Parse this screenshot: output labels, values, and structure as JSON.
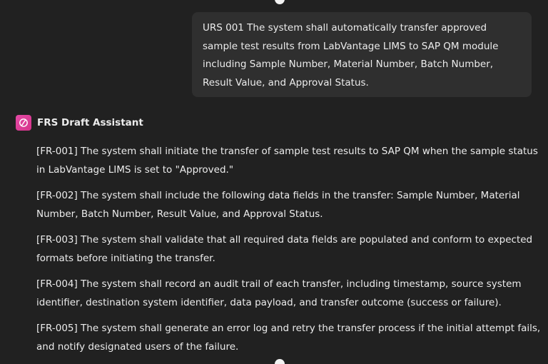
{
  "user_message": {
    "text": "URS 001 The system shall automatically transfer approved sample test results from LabVantage LIMS to SAP QM module including Sample Number, Material Number, Batch Number, Result Value, and Approval Status."
  },
  "assistant": {
    "name": "FRS Draft Assistant",
    "avatar_icon": "openai-knot-icon",
    "avatar_color": "#e44aa6"
  },
  "requirements": [
    {
      "text": "[FR-001] The system shall initiate the transfer of sample test results to SAP QM when the sample status in LabVantage LIMS is set to \"Approved.\""
    },
    {
      "text": "[FR-002] The system shall include the following data fields in the transfer: Sample Number, Material Number, Batch Number, Result Value, and Approval Status."
    },
    {
      "text": "[FR-003] The system shall validate that all required data fields are populated and conform to expected formats before initiating the transfer."
    },
    {
      "text": "[FR-004] The system shall record an audit trail of each transfer, including timestamp, source system identifier, destination system identifier, data payload, and transfer outcome (success or failure)."
    },
    {
      "text": "[FR-005] The system shall generate an error log and retry the transfer process if the initial attempt fails, and notify designated users of the failure."
    }
  ]
}
